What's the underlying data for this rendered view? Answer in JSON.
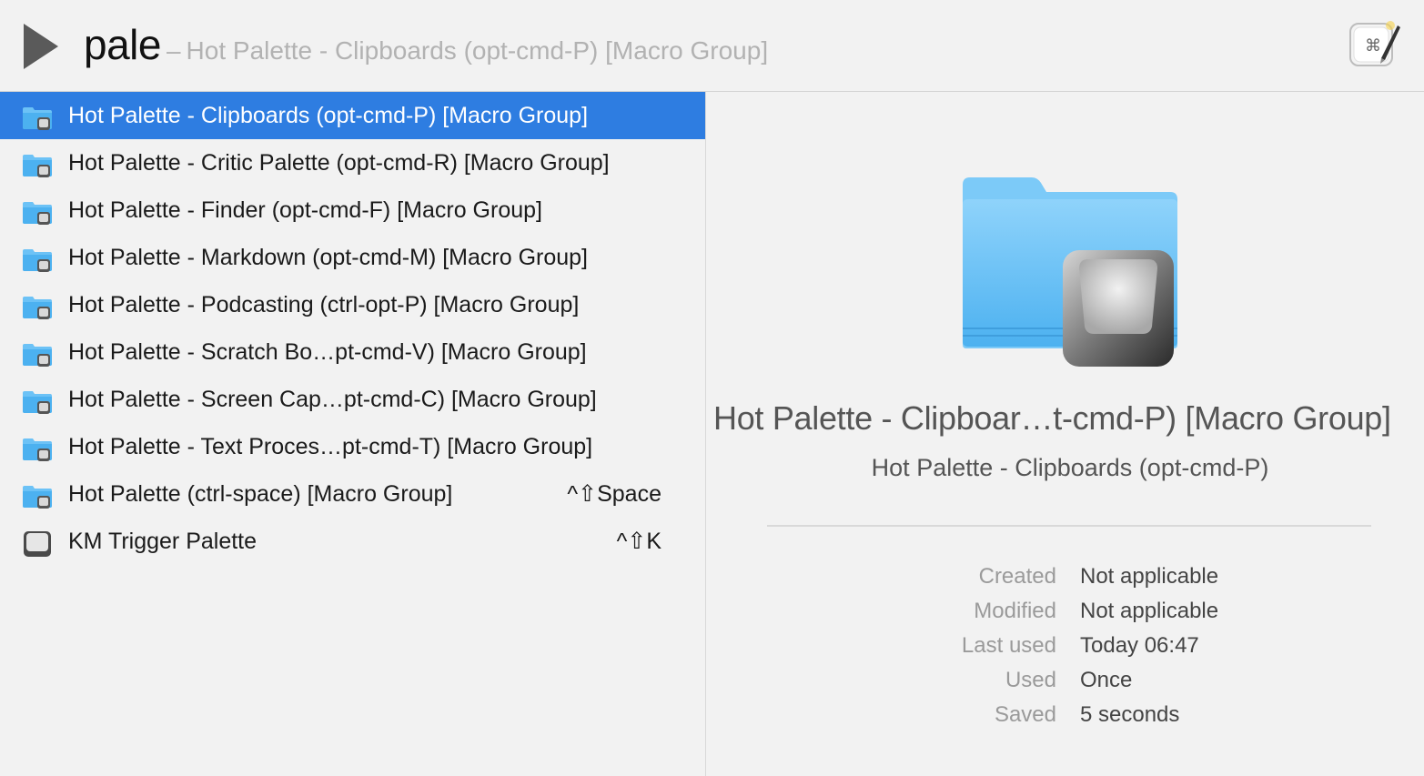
{
  "search": {
    "query": "pale",
    "separator": "–",
    "suggestion": "Hot Palette - Clipboards (opt-cmd-P) [Macro Group]"
  },
  "results": [
    {
      "label": "Hot Palette - Clipboards (opt-cmd-P) [Macro Group]",
      "shortcut": "",
      "icon": "macro-group-folder-icon",
      "selected": true
    },
    {
      "label": "Hot Palette - Critic Palette (opt-cmd-R) [Macro Group]",
      "shortcut": "",
      "icon": "macro-group-folder-icon"
    },
    {
      "label": "Hot Palette - Finder (opt-cmd-F) [Macro Group]",
      "shortcut": "",
      "icon": "macro-group-folder-icon"
    },
    {
      "label": "Hot Palette - Markdown (opt-cmd-M) [Macro Group]",
      "shortcut": "",
      "icon": "macro-group-folder-icon"
    },
    {
      "label": "Hot Palette - Podcasting (ctrl-opt-P) [Macro Group]",
      "shortcut": "",
      "icon": "macro-group-folder-icon"
    },
    {
      "label": "Hot Palette - Scratch Bo…pt-cmd-V) [Macro Group]",
      "shortcut": "",
      "icon": "macro-group-folder-icon"
    },
    {
      "label": "Hot Palette - Screen Cap…pt-cmd-C) [Macro Group]",
      "shortcut": "",
      "icon": "macro-group-folder-icon"
    },
    {
      "label": "Hot Palette - Text Proces…pt-cmd-T) [Macro Group]",
      "shortcut": "",
      "icon": "macro-group-folder-icon"
    },
    {
      "label": "Hot Palette (ctrl-space) [Macro Group]",
      "shortcut": "^⇧Space",
      "icon": "macro-group-folder-icon"
    },
    {
      "label": "KM Trigger Palette",
      "shortcut": "^⇧K",
      "icon": "keyboard-key-icon"
    }
  ],
  "detail": {
    "title": "Hot Palette - Clipboar…t-cmd-P) [Macro Group]",
    "subtitle": "Hot Palette - Clipboards (opt-cmd-P)",
    "info": [
      {
        "key": "Created",
        "value": "Not applicable"
      },
      {
        "key": "Modified",
        "value": "Not applicable"
      },
      {
        "key": "Last used",
        "value": "Today 06:47"
      },
      {
        "key": "Used",
        "value": "Once"
      },
      {
        "key": "Saved",
        "value": "5 seconds"
      }
    ]
  },
  "colors": {
    "selection": "#2e7de1",
    "folder": "#5ab8f5",
    "background": "#f2f2f2"
  }
}
